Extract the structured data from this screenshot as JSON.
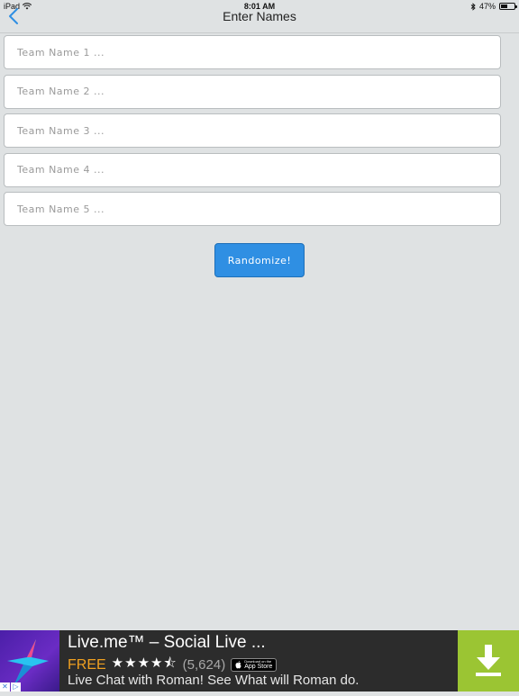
{
  "status_bar": {
    "device": "iPad",
    "time": "8:01 AM",
    "battery_text": "47%",
    "battery_level": 0.47
  },
  "nav": {
    "title": "Enter Names",
    "back_icon": "chevron-left-icon",
    "accent_color": "#2f8fe3"
  },
  "team_inputs": [
    {
      "placeholder": "Team Name 1 ...",
      "value": ""
    },
    {
      "placeholder": "Team Name 2 ...",
      "value": ""
    },
    {
      "placeholder": "Team Name 3 ...",
      "value": ""
    },
    {
      "placeholder": "Team Name 4 ...",
      "value": ""
    },
    {
      "placeholder": "Team Name 5 ...",
      "value": ""
    }
  ],
  "randomize_button": {
    "label": "Randomize!",
    "color": "#2f8fe3"
  },
  "ad": {
    "title": "Live.me™ – Social Live ...",
    "price": "FREE",
    "stars": "★★★★⯪",
    "rating_value": 4.5,
    "rating_count": "(5,624)",
    "badge_small": "Download on the",
    "badge_big": "App Store",
    "description": "Live Chat with Roman! See What will Roman do.",
    "close_labels": [
      "✕",
      "▷"
    ],
    "download_color": "#9bc533"
  }
}
